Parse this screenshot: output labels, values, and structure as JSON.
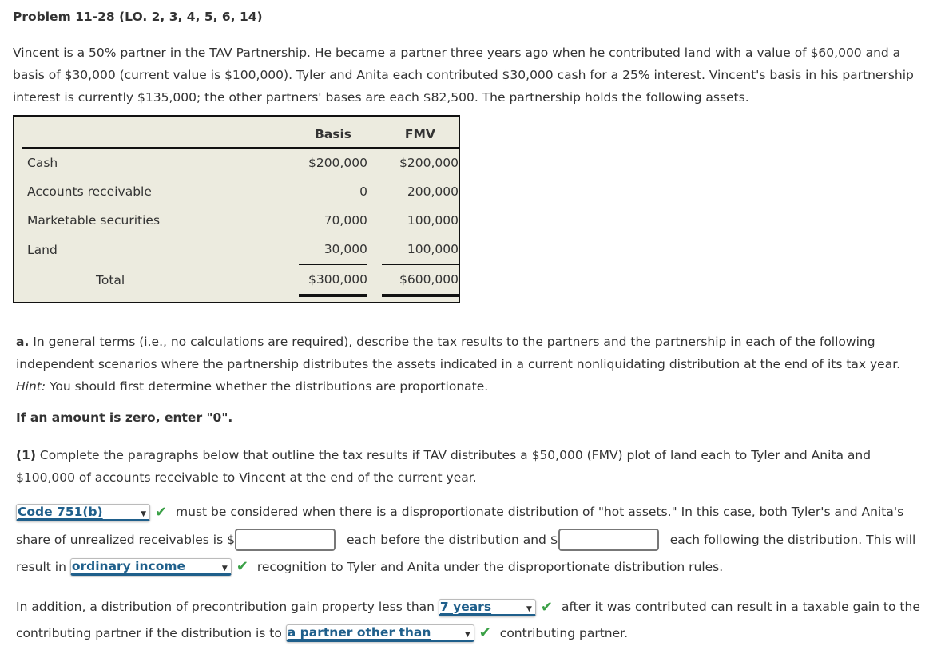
{
  "title": "Problem 11-28 (LO. 2, 3, 4, 5, 6, 14)",
  "intro": "Vincent is a 50% partner in the TAV Partnership. He became a partner three years ago when he contributed land with a value of $60,000 and a basis of $30,000 (current value is $100,000). Tyler and Anita each contributed $30,000 cash for a 25% interest. Vincent's basis in his partnership interest is currently $135,000; the other partners' bases are each $82,500. The partnership holds the following assets.",
  "asset_table": {
    "headers": [
      "",
      "Basis",
      "FMV"
    ],
    "rows": [
      {
        "label": "Cash",
        "basis": "$200,000",
        "fmv": "$200,000"
      },
      {
        "label": "Accounts receivable",
        "basis": "0",
        "fmv": "200,000"
      },
      {
        "label": "Marketable securities",
        "basis": "70,000",
        "fmv": "100,000"
      },
      {
        "label": "Land",
        "basis": "30,000",
        "fmv": "100,000"
      }
    ],
    "total": {
      "label": "Total",
      "basis": "$300,000",
      "fmv": "$600,000"
    }
  },
  "part_a": {
    "label": "a.",
    "text1": " In general terms (i.e., no calculations are required), describe the tax results to the partners and the partnership in each of the following independent scenarios where the partnership distributes the assets indicated in a current nonliquidating distribution at the end of its tax year. ",
    "hint_label": "Hint:",
    "text2": " You should first determine whether the distributions are proportionate."
  },
  "zero_note": "If an amount is zero, enter \"0\".",
  "part_1": {
    "label": "(1)",
    "text": "  Complete the paragraphs below that outline the tax results if TAV distributes a $50,000 (FMV) plot of land each to Tyler and Anita and $100,000 of accounts receivable to Vincent at the end of the current year."
  },
  "question1": {
    "select1": "Code 751(b)",
    "text1": " must be considered when there is a disproportionate distribution of \"hot assets.\" In this case, both Tyler's and Anita's share of unrealized receivables is $",
    "input1_value": "",
    "text2": "each before the distribution and $",
    "input2_value": "",
    "text3": "each following the distribution. This will result in ",
    "select2": "ordinary income",
    "text4": " recognition to Tyler and Anita under the disproportionate distribution rules."
  },
  "question2": {
    "text1": "In addition, a distribution of precontribution gain property less than ",
    "select1": "7 years",
    "text2": " after it was contributed can result in a taxable gain to the contributing partner if the distribution is to ",
    "select2": "a partner other than",
    "text3": " contributing partner."
  },
  "icons": {
    "check": "✔",
    "dropdown": "▼"
  },
  "colors": {
    "select_text": "#1f5f8b",
    "check": "#3aa046",
    "table_bg": "#ecebdf"
  }
}
